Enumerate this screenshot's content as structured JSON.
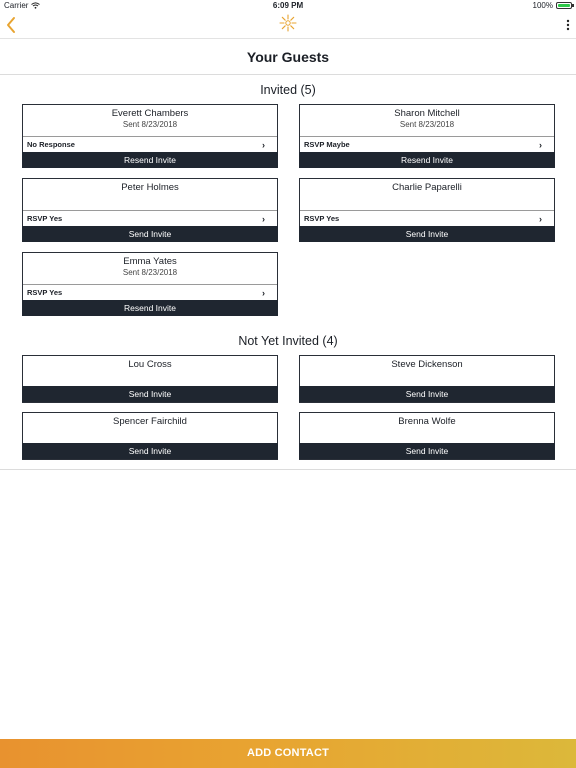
{
  "status_bar": {
    "carrier": "Carrier",
    "time": "6:09 PM",
    "battery": "100%"
  },
  "nav": {
    "back_icon": "chevron-left-icon",
    "logo_icon": "sun-logo-icon",
    "menu_icon": "more-vertical-icon"
  },
  "page_title": "Your Guests",
  "invited": {
    "heading": "Invited (5)",
    "guests": [
      {
        "name": "Everett Chambers",
        "sent": "Sent 8/23/2018",
        "status": "No Response",
        "action": "Resend Invite"
      },
      {
        "name": "Sharon Mitchell",
        "sent": "Sent 8/23/2018",
        "status": "RSVP Maybe",
        "action": "Resend Invite"
      },
      {
        "name": "Peter Holmes",
        "sent": "",
        "status": "RSVP Yes",
        "action": "Send Invite"
      },
      {
        "name": "Charlie Paparelli",
        "sent": "",
        "status": "RSVP Yes",
        "action": "Send Invite"
      },
      {
        "name": "Emma Yates",
        "sent": "Sent 8/23/2018",
        "status": "RSVP Yes",
        "action": "Resend Invite"
      }
    ]
  },
  "not_invited": {
    "heading": "Not Yet Invited (4)",
    "guests": [
      {
        "name": "Lou Cross",
        "action": "Send Invite"
      },
      {
        "name": "Steve Dickenson",
        "action": "Send Invite"
      },
      {
        "name": "Spencer Fairchild",
        "action": "Send Invite"
      },
      {
        "name": "Brenna Wolfe",
        "action": "Send Invite"
      }
    ]
  },
  "chevron_glyph": "›",
  "footer": {
    "add_contact_label": "ADD CONTACT"
  },
  "colors": {
    "accent": "#E8A431",
    "dark_button": "#1F2630",
    "gradient_start": "#E8922F",
    "gradient_end": "#DCB83A"
  }
}
